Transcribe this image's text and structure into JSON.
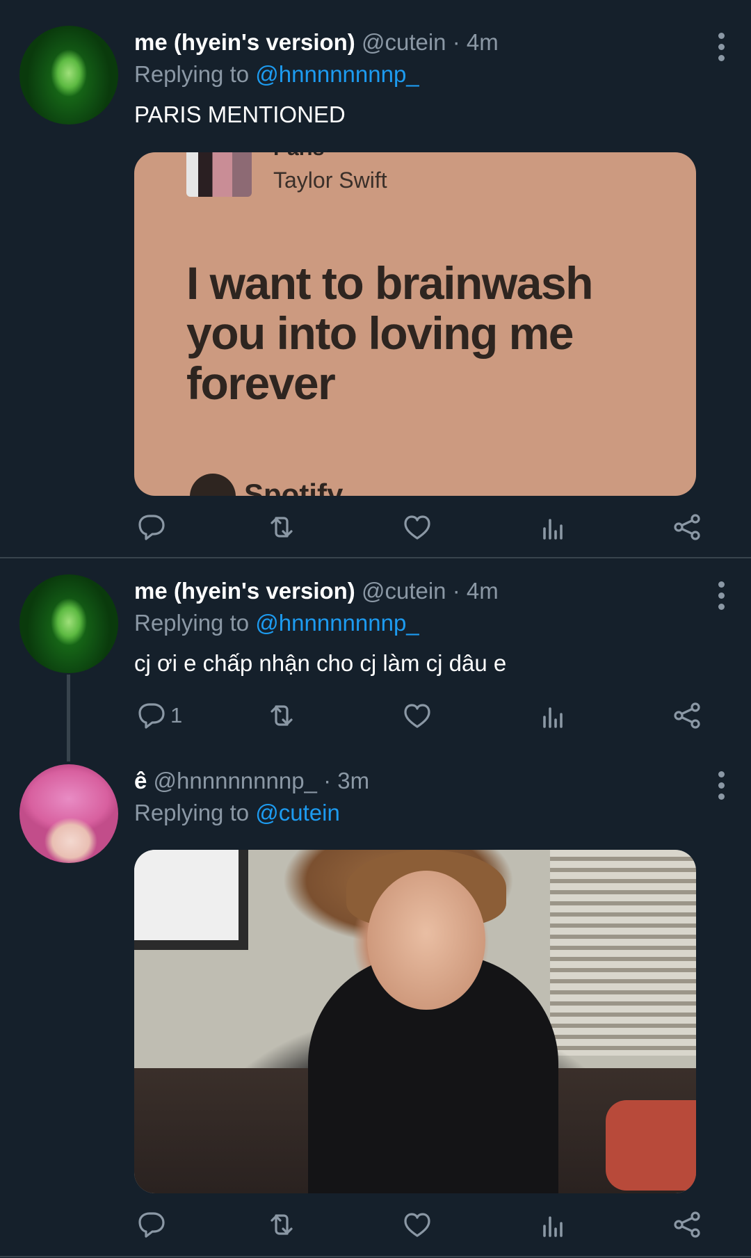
{
  "tweets": [
    {
      "display_name": "me (hyein's version)",
      "handle": "@cutein",
      "separator": "·",
      "time": "4m",
      "replying_prefix": "Replying to",
      "replying_to": "@hnnnnnnnnp_",
      "text": "PARIS MENTIONED",
      "media": {
        "type": "lyric-card",
        "song": "Paris",
        "artist": "Taylor Swift",
        "lyric": "I want to brainwash you into loving me forever",
        "brand": "Spotify"
      },
      "actions": {
        "reply_count": "",
        "retweet_count": "",
        "like_count": ""
      }
    },
    {
      "display_name": "me (hyein's version)",
      "handle": "@cutein",
      "separator": "·",
      "time": "4m",
      "replying_prefix": "Replying to",
      "replying_to": "@hnnnnnnnnp_",
      "text": "cj ơi e chấp nhận cho cj làm cj dâu e",
      "actions": {
        "reply_count": "1",
        "retweet_count": "",
        "like_count": ""
      }
    },
    {
      "display_name": "ê",
      "handle": "@hnnnnnnnnp_",
      "separator": "·",
      "time": "3m",
      "replying_prefix": "Replying to",
      "replying_to": "@cutein",
      "media": {
        "type": "photo"
      },
      "actions": {
        "reply_count": "",
        "retweet_count": "",
        "like_count": ""
      }
    }
  ],
  "colors": {
    "background": "#15202b",
    "text": "#ffffff",
    "muted": "#8b98a5",
    "link": "#1d9bf0",
    "divider": "#38444d",
    "lyric_card": "#cc9a80"
  },
  "icons": [
    "reply-icon",
    "retweet-icon",
    "like-icon",
    "analytics-icon",
    "share-icon",
    "more-icon"
  ]
}
